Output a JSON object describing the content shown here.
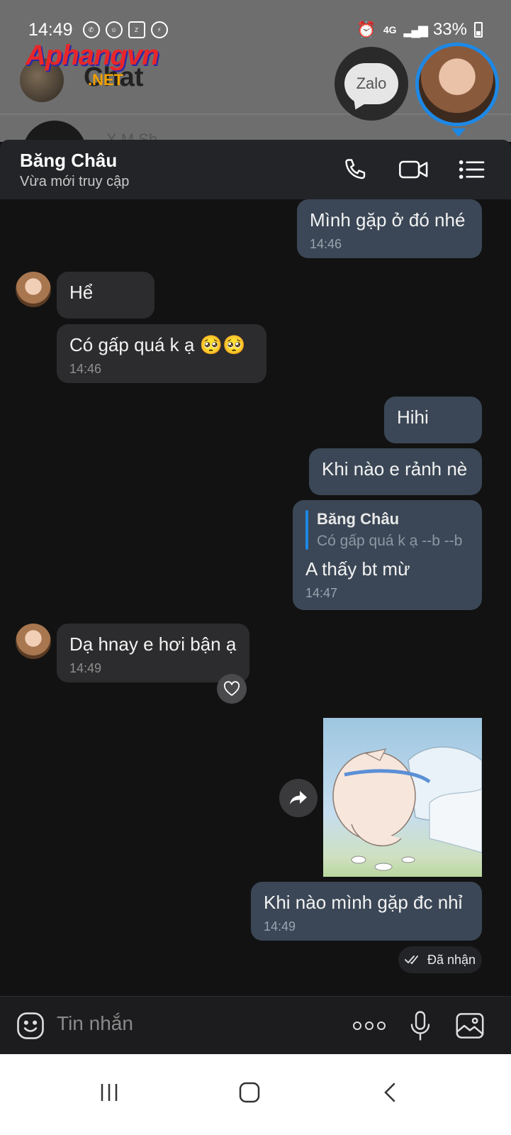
{
  "status_bar": {
    "time": "14:49",
    "network": "4G",
    "battery": "33%"
  },
  "background_app": {
    "title": "Chat",
    "watermark": "Aphangvn",
    "watermark_suffix": ".NET",
    "bubble_app_label": "Zalo",
    "row_preview": "X M Sh"
  },
  "chat": {
    "contact_name": "Băng Châu",
    "contact_status": "Vừa mới truy cập"
  },
  "messages": [
    {
      "dir": "out",
      "text": "Mình gặp ở đó nhé",
      "time": "14:46"
    },
    {
      "dir": "in",
      "text": "Hể",
      "time": ""
    },
    {
      "dir": "in",
      "text": "Có gấp quá k ạ 🥺🥺",
      "time": "14:46"
    },
    {
      "dir": "out",
      "text": "Hihi",
      "time": ""
    },
    {
      "dir": "out",
      "text": "Khi nào e rảnh nè",
      "time": ""
    },
    {
      "dir": "out",
      "quote_name": "Băng Châu",
      "quote_text": "Có gấp quá k ạ --b --b",
      "text": "A thấy bt mừ",
      "time": "14:47"
    },
    {
      "dir": "in",
      "text": "Dạ hnay e hơi bận ạ",
      "time": "14:49"
    },
    {
      "dir": "out",
      "text": "Khi nào mình gặp đc nhỉ",
      "time": "14:49"
    }
  ],
  "delivery_status": "Đã nhận",
  "input": {
    "placeholder": "Tin nhắn"
  },
  "colors": {
    "outgoing_bubble": "#3b4756",
    "incoming_bubble": "#2c2c2e",
    "accent": "#1e88e5"
  }
}
